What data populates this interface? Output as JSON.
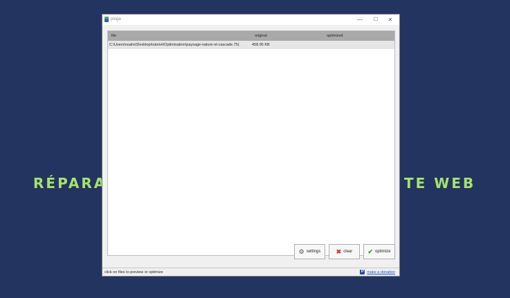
{
  "background": {
    "text_left": "RÉPARA",
    "text_right": "TE WEB",
    "text_color": "#a6e36b",
    "bg_color": "#233461"
  },
  "window": {
    "title": "pinga",
    "icon": "pinga-app-icon",
    "controls": {
      "minimize": "—",
      "maximize": "☐",
      "close": "✕"
    }
  },
  "filelist": {
    "columns": [
      "file",
      "original",
      "optimized"
    ],
    "rows": [
      {
        "file": "C:\\Users\\noahs\\Desktop\\tutoriel\\Optimisation\\paysage-nature-et-cascade.75(",
        "original": "458.95 KB",
        "optimized": ""
      }
    ]
  },
  "buttons": {
    "settings": "settings",
    "clear": "clear",
    "optimize": "optimize"
  },
  "statusbar": {
    "text": "click on files to preview or optimize",
    "donate_label": "make a donation",
    "paypal_glyph": "P"
  }
}
